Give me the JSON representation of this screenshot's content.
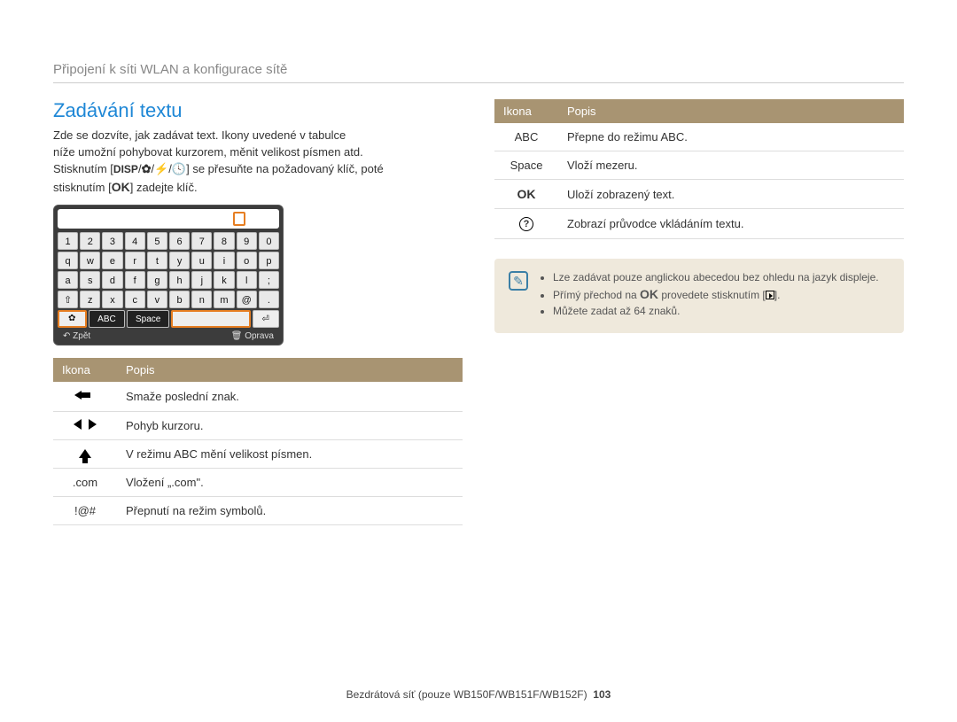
{
  "header": "Připojení k síti WLAN a konﬁgurace sítě",
  "section_title": "Zadávání textu",
  "intro_lines": {
    "l1": "Zde se dozvíte, jak zadávat text. Ikony uvedené v tabulce",
    "l2": "níže umožní pohybovat kurzorem, měnit velikost písmen atd.",
    "l3a": "Stisknutím [",
    "disp": "DISP",
    "l3b": "] se přesuňte na požadovaný klíč, poté",
    "l4a": "stisknutím [",
    "ok": "OK",
    "l4b": "] zadejte klíč."
  },
  "keyboard": {
    "rows": [
      [
        "1",
        "2",
        "3",
        "4",
        "5",
        "6",
        "7",
        "8",
        "9",
        "0"
      ],
      [
        "q",
        "w",
        "e",
        "r",
        "t",
        "y",
        "u",
        "i",
        "o",
        "p"
      ],
      [
        "a",
        "s",
        "d",
        "f",
        "g",
        "h",
        "j",
        "k",
        "l",
        ";"
      ],
      [
        "⇧",
        "z",
        "x",
        "c",
        "v",
        "b",
        "n",
        "m",
        "@",
        "."
      ]
    ],
    "bottom": {
      "abc": "ABC",
      "space": "Space"
    },
    "foot_left": "Zpět",
    "foot_right": "Oprava"
  },
  "table_left": {
    "head_icon": "Ikona",
    "head_desc": "Popis",
    "rows": [
      {
        "icon_type": "back",
        "desc": "Smaže poslední znak."
      },
      {
        "icon_type": "lr",
        "desc": "Pohyb kurzoru."
      },
      {
        "icon_type": "up",
        "desc": "V režimu ABC mění velikost písmen."
      },
      {
        "icon_type": "text",
        "icon_text": ".com",
        "desc": "Vložení „.com\"."
      },
      {
        "icon_type": "text",
        "icon_text": "!@#",
        "desc": "Přepnutí na režim symbolů."
      }
    ]
  },
  "table_right": {
    "head_icon": "Ikona",
    "head_desc": "Popis",
    "rows": [
      {
        "icon_type": "text",
        "icon_text": "ABC",
        "desc": "Přepne do režimu ABC."
      },
      {
        "icon_type": "text",
        "icon_text": "Space",
        "desc": "Vloží mezeru."
      },
      {
        "icon_type": "ok",
        "desc": "Uloží zobrazený text."
      },
      {
        "icon_type": "q",
        "desc": "Zobrazí průvodce vkládáním textu."
      }
    ]
  },
  "note": {
    "items": [
      "Lze zadávat pouze anglickou abecedou bez ohledu na jazyk displeje.",
      {
        "pre": "Přímý přechod na ",
        "ok": "OK",
        "mid": " provedete stisknutím [",
        "post": "]."
      },
      "Můžete zadat až 64 znaků."
    ]
  },
  "footer": {
    "text": "Bezdrátová síť (pouze WB150F/WB151F/WB152F)",
    "page": "103"
  }
}
